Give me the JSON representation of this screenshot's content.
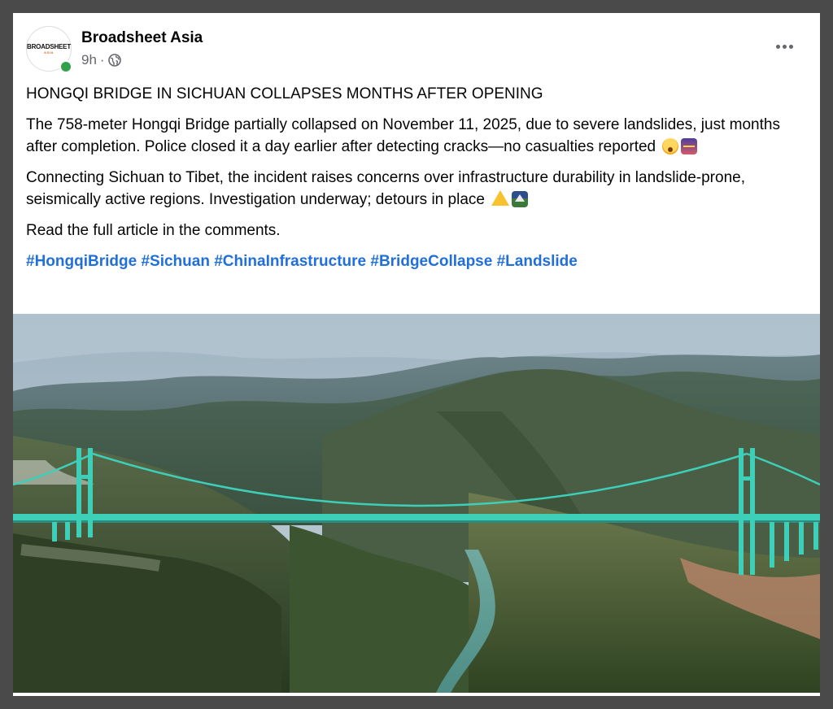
{
  "post": {
    "page_name": "Broadsheet Asia",
    "avatar_logo_main": "BROADSHEET",
    "avatar_logo_sub": "ASIA",
    "time": "9h",
    "separator": "·",
    "audience_icon": "globe-icon",
    "more_icon": "more-options-icon",
    "headline": "HONGQI BRIDGE IN SICHUAN COLLAPSES MONTHS AFTER OPENING",
    "paragraph1": "The 758-meter Hongqi Bridge partially collapsed on November 11, 2025, due to severe landslides, just months after completion. Police closed it a day earlier after detecting cracks—no casualties reported",
    "paragraph1_emojis": [
      "astonished-face-emoji",
      "bridge-at-night-emoji"
    ],
    "paragraph2": "Connecting Sichuan to Tibet, the incident raises concerns over infrastructure durability in landslide-prone, seismically active regions. Investigation underway; detours in place",
    "paragraph2_emojis": [
      "warning-emoji",
      "mountain-sunrise-emoji"
    ],
    "read_more": "Read the full article in the comments.",
    "hashtags": [
      "#HongqiBridge",
      "#Sichuan",
      "#ChinaInfrastructure",
      "#BridgeCollapse",
      "#Landslide"
    ]
  },
  "colors": {
    "link": "#216fdb",
    "online": "#31a24c",
    "bridge": "#3ecfb9",
    "background": "#4a4a4a"
  }
}
